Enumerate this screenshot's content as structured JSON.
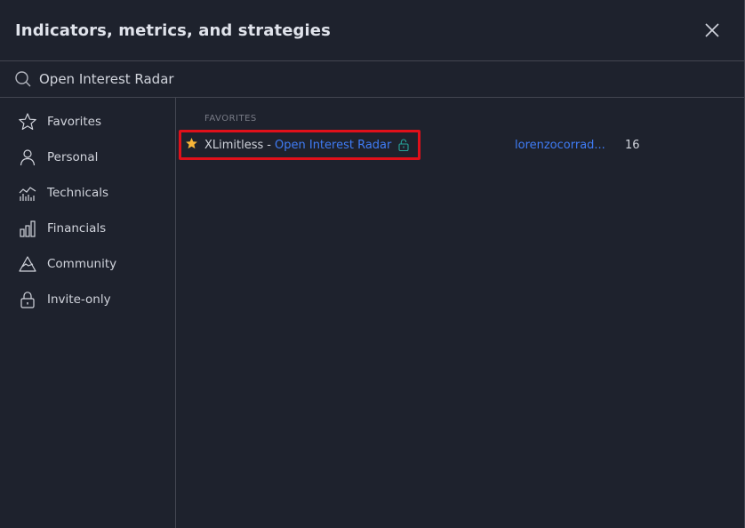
{
  "header": {
    "title": "Indicators, metrics, and strategies"
  },
  "search": {
    "value": "Open Interest Radar",
    "placeholder": "Search"
  },
  "sidebar": {
    "items": [
      {
        "label": "Favorites",
        "icon": "star-outline-icon"
      },
      {
        "label": "Personal",
        "icon": "person-icon"
      },
      {
        "label": "Technicals",
        "icon": "technicals-chart-icon"
      },
      {
        "label": "Financials",
        "icon": "bar-chart-icon"
      },
      {
        "label": "Community",
        "icon": "community-mountain-icon"
      },
      {
        "label": "Invite-only",
        "icon": "lock-icon"
      }
    ]
  },
  "main": {
    "section_label": "FAVORITES",
    "rows": [
      {
        "author": "XLimitless",
        "separator": "-",
        "script": "Open Interest Radar",
        "owner": "lorenzocorrad...",
        "likes": "16"
      }
    ]
  },
  "colors": {
    "background": "#1e222d",
    "divider": "#434651",
    "link": "#3f7cf6",
    "star": "#f7b538",
    "lock": "#26a69a",
    "highlight": "#e0101a"
  }
}
